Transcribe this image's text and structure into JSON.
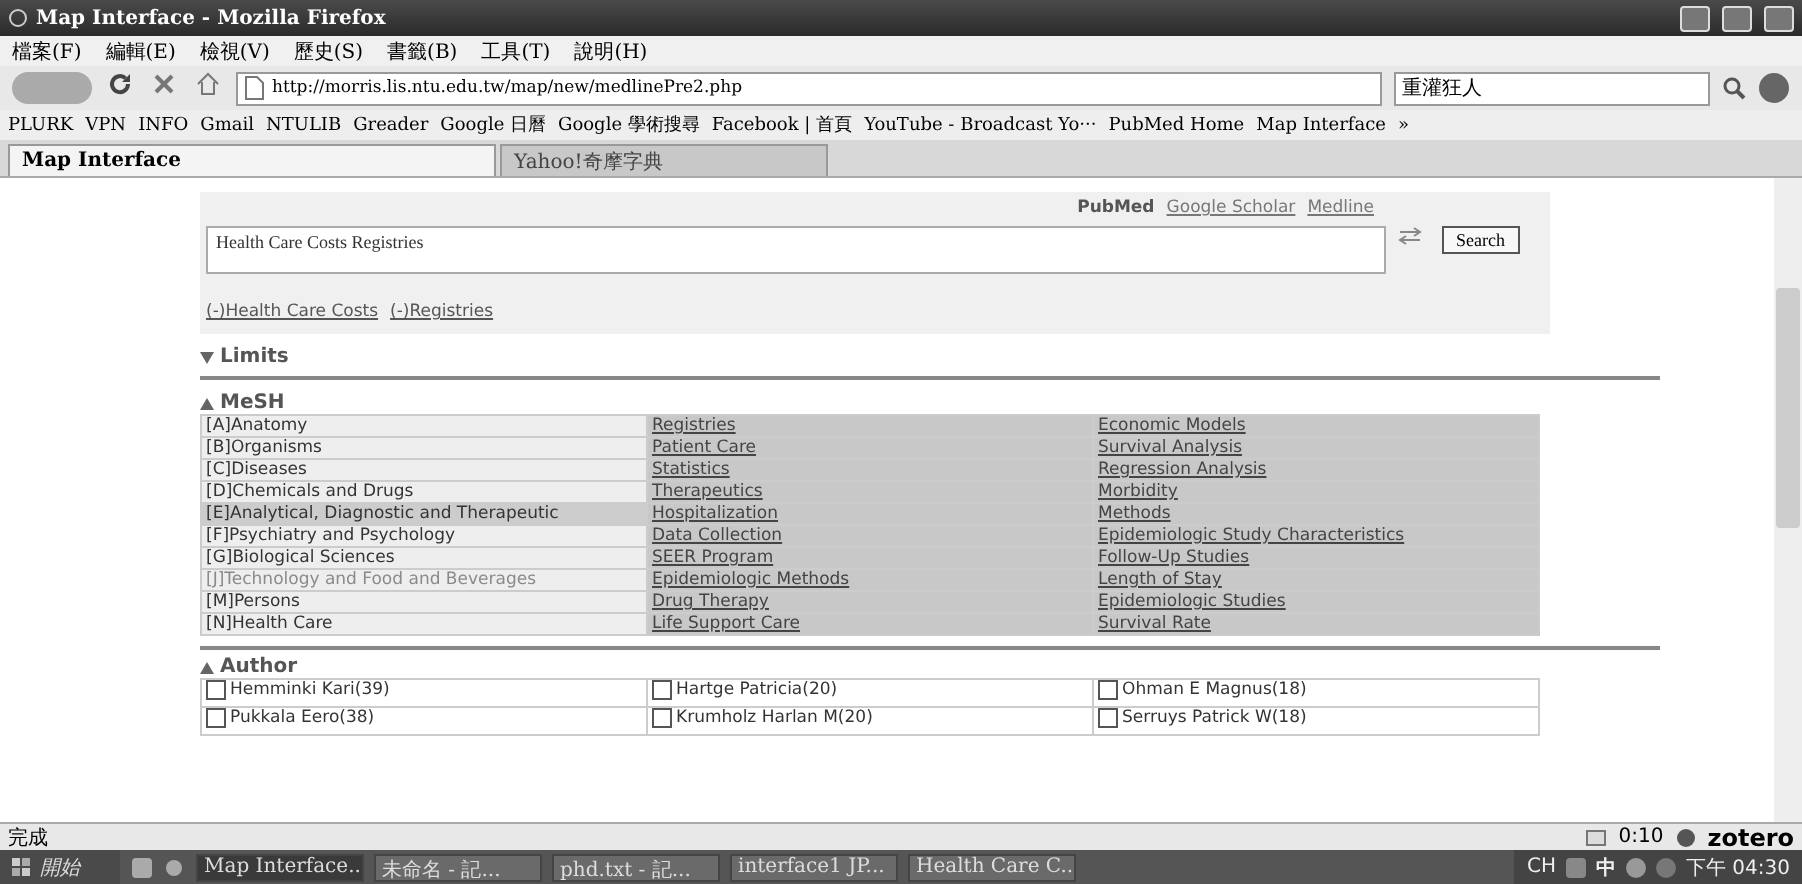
{
  "window": {
    "title": "Map Interface - Mozilla Firefox"
  },
  "menu": [
    "檔案(F)",
    "編輯(E)",
    "檢視(V)",
    "歷史(S)",
    "書籤(B)",
    "工具(T)",
    "說明(H)"
  ],
  "address": {
    "value": "http://morris.lis.ntu.edu.tw/map/new/medlinePre2.php"
  },
  "web_search": {
    "value": "重灌狂人"
  },
  "bookmarks": [
    "PLURK",
    "VPN",
    "INFO",
    "Gmail",
    "NTULIB",
    "Greader",
    "Google 日曆",
    "Google 學術搜尋",
    "Facebook | 首頁",
    "YouTube - Broadcast Yo···",
    "PubMed Home",
    "Map Interface",
    "»"
  ],
  "tabs": [
    {
      "label": "Map Interface",
      "selected": true
    },
    {
      "label": "Yahoo!奇摩字典",
      "selected": false
    }
  ],
  "sources": [
    {
      "label": "PubMed",
      "selected": true
    },
    {
      "label": "Google Scholar",
      "selected": false
    },
    {
      "label": "Medline",
      "selected": false
    }
  ],
  "query": {
    "value": "Health Care Costs Registries"
  },
  "search_button": "Search",
  "terms": [
    "(-)Health Care Costs",
    "(-)Registries"
  ],
  "limits": {
    "label": "Limits",
    "expanded": false
  },
  "mesh": {
    "label": "MeSH",
    "expanded": true,
    "rows": [
      {
        "category": "[A]Anatomy",
        "highlighted": false,
        "disabled": false,
        "term_1": "Registries",
        "term_2": "Economic Models"
      },
      {
        "category": "[B]Organisms",
        "highlighted": false,
        "disabled": false,
        "term_1": "Patient Care",
        "term_2": "Survival Analysis"
      },
      {
        "category": "[C]Diseases",
        "highlighted": false,
        "disabled": false,
        "term_1": "Statistics",
        "term_2": "Regression Analysis"
      },
      {
        "category": "[D]Chemicals and Drugs",
        "highlighted": false,
        "disabled": false,
        "term_1": "Therapeutics",
        "term_2": "Morbidity"
      },
      {
        "category": "[E]Analytical, Diagnostic and Therapeutic",
        "highlighted": true,
        "disabled": false,
        "term_1": "Hospitalization",
        "term_2": "Methods"
      },
      {
        "category": "[F]Psychiatry and Psychology",
        "highlighted": false,
        "disabled": false,
        "term_1": "Data Collection",
        "term_2": "Epidemiologic Study Characteristics"
      },
      {
        "category": "[G]Biological Sciences",
        "highlighted": false,
        "disabled": false,
        "term_1": "SEER Program",
        "term_2": "Follow-Up Studies"
      },
      {
        "category": "[J]Technology and Food and Beverages",
        "highlighted": false,
        "disabled": true,
        "term_1": "Epidemiologic Methods",
        "term_2": "Length of Stay"
      },
      {
        "category": "[M]Persons",
        "highlighted": false,
        "disabled": false,
        "term_1": "Drug Therapy",
        "term_2": "Epidemiologic Studies"
      },
      {
        "category": "[N]Health Care",
        "highlighted": false,
        "disabled": false,
        "term_1": "Life Support Care",
        "term_2": "Survival Rate"
      }
    ]
  },
  "author": {
    "label": "Author",
    "expanded": true,
    "rows": [
      [
        {
          "name": "Hemminki Kari(39)",
          "checked": false
        },
        {
          "name": "Hartge Patricia(20)",
          "checked": false
        },
        {
          "name": "Ohman E Magnus(18)",
          "checked": false
        }
      ],
      [
        {
          "name": "Pukkala Eero(38)",
          "checked": false
        },
        {
          "name": "Krumholz Harlan M(20)",
          "checked": false
        },
        {
          "name": "Serruys Patrick W(18)",
          "checked": false
        }
      ]
    ]
  },
  "status_bar": {
    "text": "完成",
    "time": "0:10",
    "addon": "zotero"
  },
  "taskbar": {
    "start": "開始",
    "tasks": [
      {
        "label": "Map Interface...",
        "selected": true
      },
      {
        "label": "未命名 - 記...",
        "selected": false
      },
      {
        "label": "phd.txt - 記...",
        "selected": false
      },
      {
        "label": "interface1 JP...",
        "selected": false
      },
      {
        "label": "Health Care C...",
        "selected": false
      }
    ],
    "language": "CH",
    "ime": "中",
    "clock": "下午 04:30"
  }
}
